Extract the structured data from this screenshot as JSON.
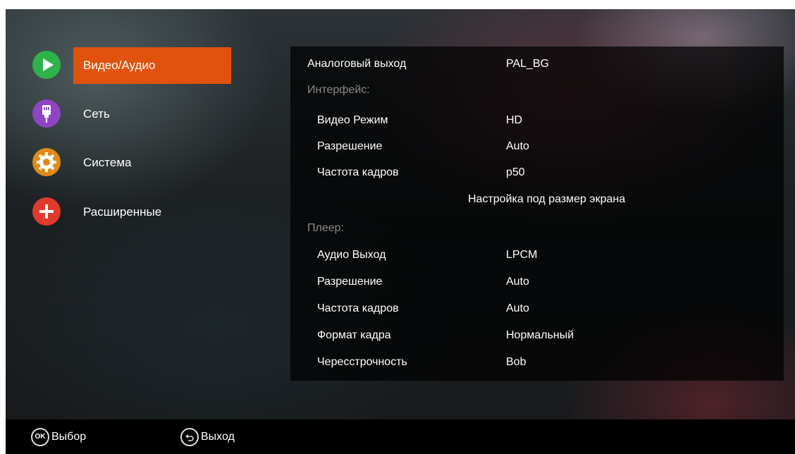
{
  "sidebar": {
    "items": [
      {
        "label": "Видео/Аудио",
        "icon": "play-icon",
        "color": "#2db34a",
        "active": true
      },
      {
        "label": "Сеть",
        "icon": "network-plug-icon",
        "color": "#8e44c4",
        "active": false
      },
      {
        "label": "Система",
        "icon": "gear-icon",
        "color": "#e08a18",
        "active": false
      },
      {
        "label": "Расширенные",
        "icon": "plus-icon",
        "color": "#e03a2e",
        "active": false
      }
    ]
  },
  "settings": {
    "analog_output": {
      "label": "Аналоговый выход",
      "value": "PAL_BG"
    },
    "interface_header": "Интерфейс:",
    "interface": [
      {
        "label": "Видео Режим",
        "value": "HD"
      },
      {
        "label": "Разрешение",
        "value": "Auto"
      },
      {
        "label": "Частота кадров",
        "value": "p50"
      }
    ],
    "screen_fit": "Настройка под размер экрана",
    "player_header": "Плеер:",
    "player": [
      {
        "label": "Аудио Выход",
        "value": "LPCM"
      },
      {
        "label": "Разрешение",
        "value": "Auto"
      },
      {
        "label": "Частота кадров",
        "value": "Auto"
      },
      {
        "label": "Формат кадра",
        "value": "Нормальный"
      },
      {
        "label": "Чересстрочность",
        "value": "Bob"
      }
    ]
  },
  "footer": {
    "ok_icon_text": "OK",
    "select_label": "Выбор",
    "exit_label": "Выход"
  },
  "colors": {
    "accent": "#e1520f"
  }
}
